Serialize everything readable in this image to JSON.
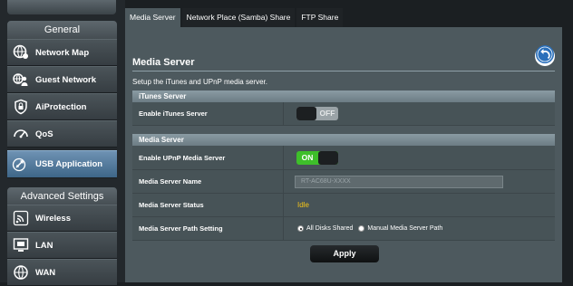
{
  "sidebar": {
    "general_header": "General",
    "items": [
      {
        "label": "Network Map",
        "icon": "network-map-icon"
      },
      {
        "label": "Guest Network",
        "icon": "guest-network-icon"
      },
      {
        "label": "AiProtection",
        "icon": "aiprotection-icon"
      },
      {
        "label": "QoS",
        "icon": "qos-icon"
      },
      {
        "label": "USB Application",
        "icon": "usb-application-icon",
        "active": true
      }
    ],
    "advanced_header": "Advanced Settings",
    "advanced_items": [
      {
        "label": "Wireless",
        "icon": "wireless-icon"
      },
      {
        "label": "LAN",
        "icon": "lan-icon"
      },
      {
        "label": "WAN",
        "icon": "wan-icon"
      }
    ]
  },
  "tabs": [
    {
      "label": "Media Server",
      "active": true
    },
    {
      "label": "Network Place (Samba) Share"
    },
    {
      "label": "FTP Share"
    }
  ],
  "main": {
    "title": "Media Server",
    "description": "Setup the iTunes and UPnP media server.",
    "itunes_section": {
      "header": "iTunes Server",
      "enable_label": "Enable iTunes Server",
      "enable_state": "OFF"
    },
    "media_section": {
      "header": "Media Server",
      "upnp_label": "Enable UPnP Media Server",
      "upnp_state": "ON",
      "name_label": "Media Server Name",
      "name_value": "RT-AC68U-XXXX",
      "status_label": "Media Server Status",
      "status_value": "Idle",
      "path_label": "Media Server Path Setting",
      "path_options": [
        "All Disks Shared",
        "Manual Media Server Path"
      ],
      "path_selected": "All Disks Shared"
    },
    "apply_label": "Apply"
  },
  "colors": {
    "panel": "#4d595e",
    "status": "#f5c518",
    "toggle_on": "#3ebf2a",
    "active_item": "#4f7a9e"
  }
}
